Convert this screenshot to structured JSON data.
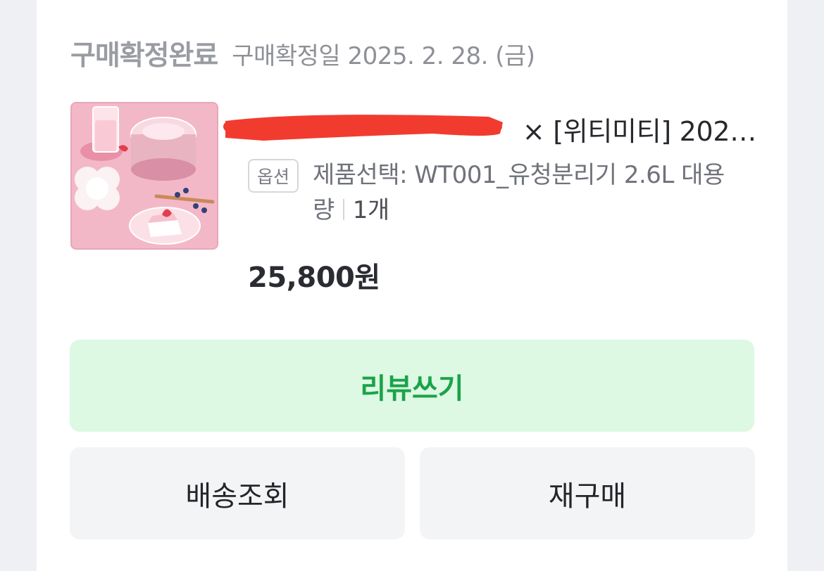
{
  "order": {
    "status_title": "구매확정완료",
    "status_date": "구매확정일 2025. 2. 28. (금)"
  },
  "product": {
    "name_visible": "× [위티미티] 202…",
    "option_badge": "옵션",
    "option_text": "제품선택: WT001_유청분리기 2.6L 대용량",
    "quantity": "1개",
    "price": "25,800원"
  },
  "actions": {
    "review_label": "리뷰쓰기",
    "track_label": "배송조회",
    "rebuy_label": "재구매"
  },
  "colors": {
    "review_bg": "#ddf8e3",
    "review_text": "#1aa34a",
    "redaction": "#f23b2f",
    "thumb_bg": "#f3b8c7"
  }
}
